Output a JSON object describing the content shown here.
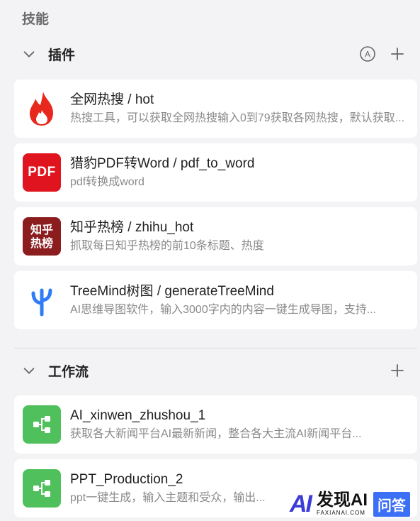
{
  "section_title": "技能",
  "plugins": {
    "label": "插件",
    "items": [
      {
        "name": "全网热搜 / hot",
        "desc": "热搜工具，可以获取全网热搜输入0到79获取各网热搜，默认获取..."
      },
      {
        "name": "猎豹PDF转Word / pdf_to_word",
        "desc": "pdf转换成word",
        "logo_text": "PDF"
      },
      {
        "name": "知乎热榜 / zhihu_hot",
        "desc": "抓取每日知乎热榜的前10条标题、热度",
        "logo_text_1": "知乎",
        "logo_text_2": "热榜"
      },
      {
        "name": "TreeMind树图 / generateTreeMind",
        "desc": "AI思维导图软件，输入3000字内的内容一键生成导图，支持..."
      }
    ]
  },
  "workflows": {
    "label": "工作流",
    "items": [
      {
        "name": "AI_xinwen_zhushou_1",
        "desc": "获取各大新闻平台AI最新新闻，整合各大主流AI新闻平台..."
      },
      {
        "name": "PPT_Production_2",
        "desc": "ppt一键生成，输入主题和受众，输出..."
      }
    ]
  },
  "watermark": {
    "ai": "AI",
    "cn": "发现AI",
    "sub": "FAXIANAI.COM",
    "tag": "问答"
  },
  "colors": {
    "background": "#f3f3f6",
    "card": "#ffffff",
    "pdf_red": "#e0141e",
    "zhihu_red": "#8b1d1f",
    "workflow_green": "#4fc05c",
    "treemind_blue": "#2f7cf6"
  },
  "icons": [
    "chevron-down-icon",
    "auto-a-icon",
    "plus-icon",
    "flame-icon",
    "tree-icon",
    "workflow-icon"
  ]
}
